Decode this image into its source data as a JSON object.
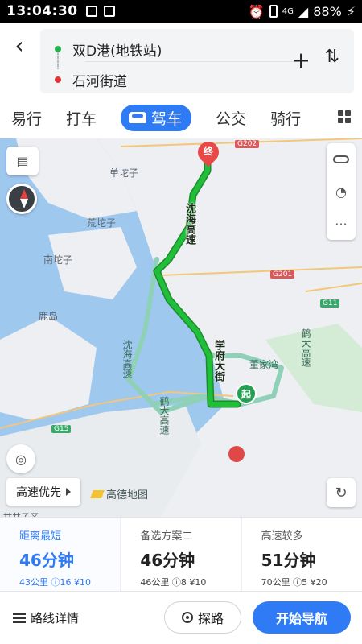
{
  "status_bar": {
    "time": "13:04:30",
    "network": "4G",
    "battery": "88%"
  },
  "search": {
    "origin": "双D港(地铁站)",
    "destination": "石河街道"
  },
  "tabs": [
    {
      "label": "易行"
    },
    {
      "label": "打车"
    },
    {
      "label": "驾车",
      "active": true
    },
    {
      "label": "公交"
    },
    {
      "label": "骑行"
    }
  ],
  "map": {
    "places": [
      "单坨子",
      "荒坨子",
      "南坨子",
      "鹿岛",
      "甘井子区"
    ],
    "roads": {
      "main_1": "沈海高速",
      "main_2": "学府大街",
      "alt_1": "沈海高速",
      "alt_2": "鹤大高速",
      "alt_3": "董家湾",
      "alt_4": "鹤大高速"
    },
    "shields": [
      "G202",
      "G201",
      "G11",
      "G15"
    ],
    "end_marker": "终",
    "start_marker": "起",
    "highway_pref": "高速优先",
    "logo": "高德地图",
    "colors": {
      "route_main": "#1fbf3a",
      "route_alt": "#8fd1b8",
      "water": "#9fc8ef",
      "land": "#edeff2"
    }
  },
  "options": [
    {
      "title": "距离最短",
      "time": "46分钟",
      "detail": "43公里 ⓘ16 ¥10",
      "active": true
    },
    {
      "title": "备选方案二",
      "time": "46分钟",
      "detail": "46公里 ⓘ8 ¥10"
    },
    {
      "title": "高速较多",
      "time": "51分钟",
      "detail": "70公里 ⓘ5 ¥20"
    }
  ],
  "bottom": {
    "details": "路线详情",
    "explore": "探路",
    "start": "开始导航"
  }
}
